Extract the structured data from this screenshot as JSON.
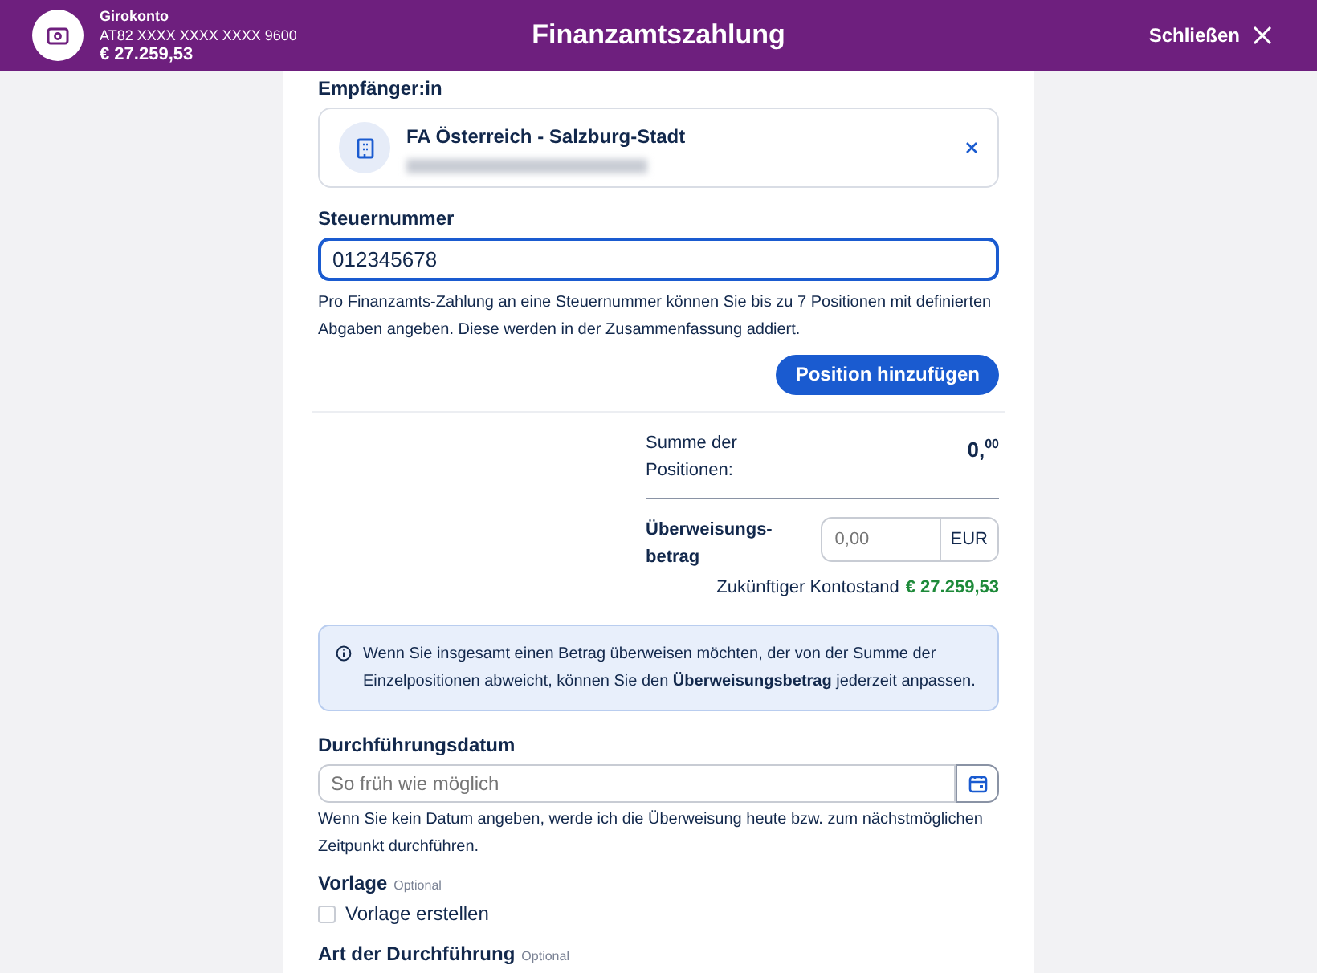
{
  "header": {
    "account_name": "Girokonto",
    "account_iban": "AT82 XXXX XXXX XXXX 9600",
    "account_balance": "€ 27.259,53",
    "title": "Finanzamtszahlung",
    "close_label": "Schließen"
  },
  "recipient": {
    "label": "Empfänger:in",
    "name": "FA Österreich - Salzburg-Stadt"
  },
  "tax_number": {
    "label": "Steuernummer",
    "value": "012345678",
    "focused": true,
    "hint": "Pro Finanzamts-Zahlung an eine Steuernummer können Sie bis zu 7 Positionen mit definierten Abgaben angeben. Diese werden in der Zusammenfassung addiert."
  },
  "add_button": "Position hinzufügen",
  "summary": {
    "sum_label": "Summe der Positionen:",
    "sum_value": "0,",
    "sum_cents": "00",
    "amount_label": "Überweisungs-betrag",
    "amount_placeholder": "0,00",
    "currency": "EUR",
    "future_label": "Zukünftiger Kontostand",
    "future_value": "€ 27.259,53"
  },
  "info": "Wenn Sie insgesamt einen Betrag überweisen möchten, der von der Summe der Einzelpositionen abweicht, können Sie den **Überweisungsbetrag** jederzeit anpassen.",
  "date": {
    "label": "Durchführungsdatum",
    "placeholder": "So früh wie möglich",
    "hint": "Wenn Sie kein Datum angeben, werde ich die Überweisung heute bzw. zum nächstmöglichen Zeitpunkt durchführen."
  },
  "template": {
    "label": "Vorlage",
    "optional": "Optional",
    "checkbox_label": "Vorlage erstellen",
    "checked": false
  },
  "execution": {
    "label": "Art der Durchführung",
    "optional": "Optional"
  }
}
